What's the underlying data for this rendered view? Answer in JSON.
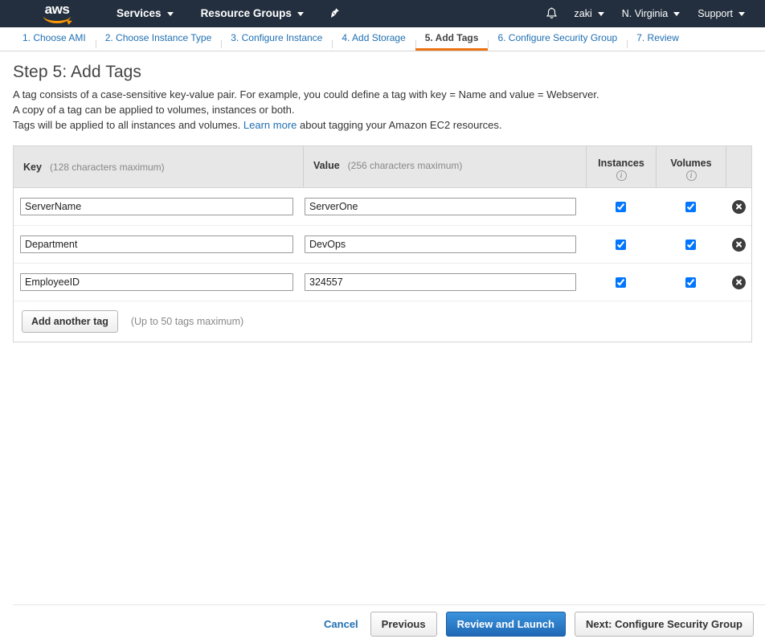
{
  "topnav": {
    "logo_text": "aws",
    "services_label": "Services",
    "resource_groups_label": "Resource Groups",
    "pin_icon": "pin-icon",
    "bell_icon": "bell-icon",
    "user_label": "zaki",
    "region_label": "N. Virginia",
    "support_label": "Support"
  },
  "tabs": [
    {
      "label": "1. Choose AMI",
      "active": false
    },
    {
      "label": "2. Choose Instance Type",
      "active": false
    },
    {
      "label": "3. Configure Instance",
      "active": false
    },
    {
      "label": "4. Add Storage",
      "active": false
    },
    {
      "label": "5. Add Tags",
      "active": true
    },
    {
      "label": "6. Configure Security Group",
      "active": false
    },
    {
      "label": "7. Review",
      "active": false
    }
  ],
  "page": {
    "title": "Step 5: Add Tags",
    "desc_line1": "A tag consists of a case-sensitive key-value pair. For example, you could define a tag with key = Name and value = Webserver.",
    "desc_line2": "A copy of a tag can be applied to volumes, instances or both.",
    "desc_line3_before": "Tags will be applied to all instances and volumes.",
    "learn_more_label": "Learn more",
    "desc_line3_after": "about tagging your Amazon EC2 resources."
  },
  "table": {
    "key_header": "Key",
    "key_hint": "(128 characters maximum)",
    "value_header": "Value",
    "value_hint": "(256 characters maximum)",
    "instances_header": "Instances",
    "volumes_header": "Volumes",
    "info_icon_glyph": "i",
    "rows": [
      {
        "key": "ServerName",
        "value": "ServerOne",
        "instances": true,
        "volumes": true
      },
      {
        "key": "Department",
        "value": "DevOps",
        "instances": true,
        "volumes": true
      },
      {
        "key": "EmployeeID",
        "value": "324557",
        "instances": true,
        "volumes": true
      }
    ],
    "key_placeholder": "",
    "value_placeholder": ""
  },
  "panel_footer": {
    "add_tag_label": "Add another tag",
    "max_tags_hint": "(Up to 50 tags maximum)"
  },
  "footer": {
    "cancel_label": "Cancel",
    "previous_label": "Previous",
    "review_launch_label": "Review and Launch",
    "next_label": "Next: Configure Security Group"
  },
  "colors": {
    "nav_bg": "#232f3e",
    "accent_orange": "#ec7211",
    "link_blue": "#1f6fb2",
    "primary_button": "#1f68b5"
  }
}
